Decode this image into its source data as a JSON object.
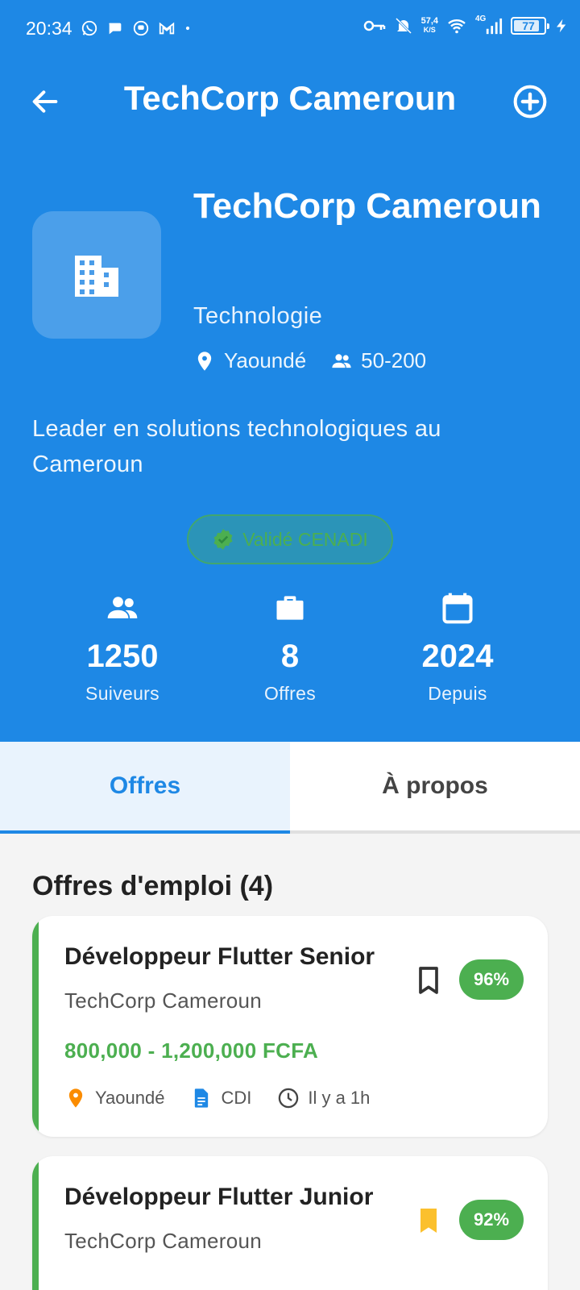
{
  "status_bar": {
    "time": "20:34",
    "net_speed_value": "57,4",
    "net_speed_unit": "K/S",
    "network_type": "4G",
    "battery": "77"
  },
  "app_bar": {
    "title": "TechCorp Cameroun"
  },
  "company": {
    "name": "TechCorp Cameroun",
    "sector": "Technologie",
    "location": "Yaoundé",
    "size": "50-200",
    "description": "Leader en solutions technologiques au Cameroun",
    "badge": "Validé CENADI"
  },
  "stats": [
    {
      "value": "1250",
      "label": "Suiveurs",
      "icon": "people-icon"
    },
    {
      "value": "8",
      "label": "Offres",
      "icon": "briefcase-icon"
    },
    {
      "value": "2024",
      "label": "Depuis",
      "icon": "calendar-icon"
    }
  ],
  "tabs": [
    {
      "label": "Offres",
      "active": true
    },
    {
      "label": "À propos",
      "active": false
    }
  ],
  "jobs_section": {
    "title": "Offres d'emploi (4)"
  },
  "jobs": [
    {
      "title": "Développeur Flutter Senior",
      "company": "TechCorp Cameroun",
      "salary": "800,000 - 1,200,000 FCFA",
      "match": "96%",
      "bookmarked": false,
      "location": "Yaoundé",
      "contract": "CDI",
      "posted": "Il y a 1h"
    },
    {
      "title": "Développeur Flutter Junior",
      "company": "TechCorp Cameroun",
      "match": "92%",
      "bookmarked": true
    }
  ],
  "colors": {
    "primary": "#1e88e5",
    "success": "#4caf50",
    "bookmark_active": "#fbc02d",
    "location_pin": "#fb8c00"
  }
}
